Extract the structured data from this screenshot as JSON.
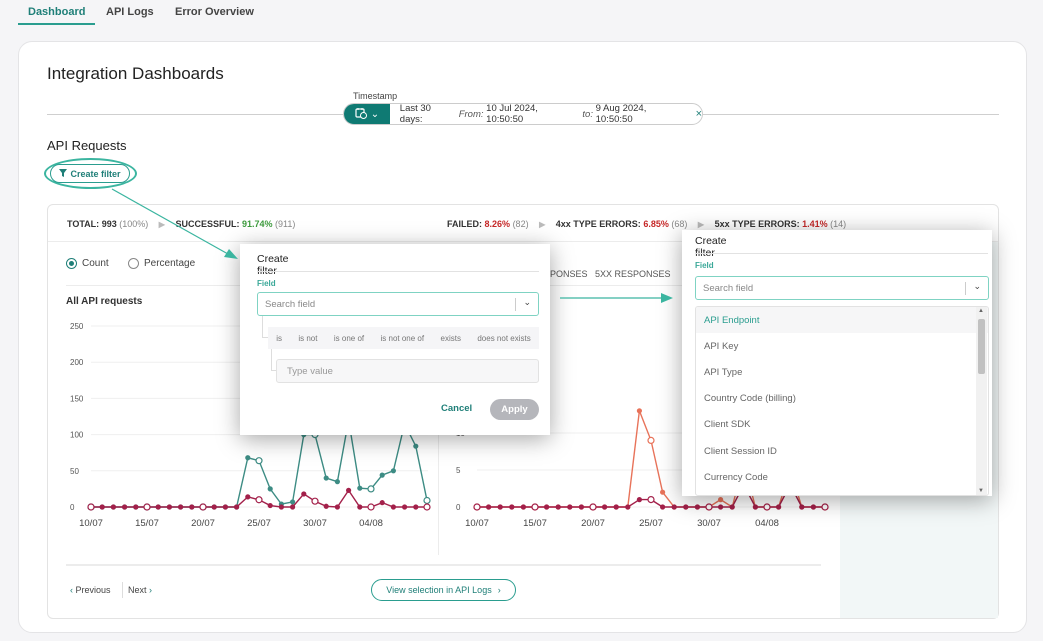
{
  "nav": {
    "tabs": [
      {
        "label": "Dashboard",
        "active": true
      },
      {
        "label": "API Logs"
      },
      {
        "label": "Error Overview"
      }
    ]
  },
  "page": {
    "title": "Integration Dashboards"
  },
  "timestamp": {
    "label": "Timestamp",
    "range_label": "Last 30 days:",
    "from_label": "From:",
    "from_value": "10 Jul 2024, 10:50:50",
    "to_label": "to:",
    "to_value": "9 Aug 2024, 10:50:50",
    "clear_icon": "×",
    "calendar_icon": "calendar-clock-icon"
  },
  "section": {
    "title": "API Requests",
    "create_filter_label": "Create filter"
  },
  "stats": {
    "total_label": "TOTAL:",
    "total_value": "993",
    "total_pct": "(100%)",
    "successful_label": "SUCCESSFUL:",
    "successful_pct": "91.74%",
    "successful_count": "(911)",
    "failed_label": "FAILED:",
    "failed_pct": "8.26%",
    "failed_count": "(82)",
    "e4xx_label": "4xx TYPE ERRORS:",
    "e4xx_pct": "6.85%",
    "e4xx_count": "(68)",
    "e5xx_label": "5xx TYPE ERRORS:",
    "e5xx_pct": "1.41%",
    "e5xx_count": "(14)"
  },
  "view_mode": {
    "count_label": "Count",
    "percentage_label": "Percentage",
    "selected": "Count"
  },
  "right_tabs": [
    "PONSES",
    "5XX RESPONSES"
  ],
  "pagination": {
    "previous": "Previous",
    "next": "Next",
    "view_selection": "View selection in API Logs"
  },
  "colors": {
    "accent": "#2a9d8f",
    "success": "#3c9a3c",
    "error": "#c62828",
    "series_teal": "#3d8c84",
    "series_maroon": "#a3204a",
    "series_orange": "#e8735a"
  },
  "filter_modal_left": {
    "title": "Create filter",
    "field_label": "Field",
    "search_placeholder": "Search field",
    "operators": [
      "is",
      "is not",
      "is one of",
      "is not one of",
      "exists",
      "does not exists"
    ],
    "value_placeholder": "Type value",
    "cancel": "Cancel",
    "apply": "Apply"
  },
  "filter_modal_right": {
    "title": "Create filter",
    "field_label": "Field",
    "search_placeholder": "Search field",
    "options": [
      "API Endpoint",
      "API Key",
      "API Type",
      "Country Code (billing)",
      "Client SDK",
      "Client Session ID",
      "Currency Code"
    ],
    "highlighted": "API Endpoint"
  },
  "chart_data": [
    {
      "type": "line",
      "title": "All API requests",
      "x": [
        "10/07",
        "11/07",
        "12/07",
        "13/07",
        "14/07",
        "15/07",
        "16/07",
        "17/07",
        "18/07",
        "19/07",
        "20/07",
        "21/07",
        "22/07",
        "23/07",
        "24/07",
        "25/07",
        "26/07",
        "27/07",
        "28/07",
        "29/07",
        "30/07",
        "31/07",
        "01/08",
        "02/08",
        "03/08",
        "04/08",
        "05/08",
        "06/08",
        "07/08",
        "08/08",
        "09/08"
      ],
      "x_tick_labels": [
        "10/07",
        "15/07",
        "20/07",
        "25/07",
        "30/07",
        "04/08"
      ],
      "y_ticks": [
        0,
        50,
        100,
        150,
        200,
        250
      ],
      "ylim": [
        0,
        250
      ],
      "grid": true,
      "series": [
        {
          "color": "#3d8c84",
          "values": [
            0,
            0,
            0,
            0,
            0,
            0,
            0,
            0,
            0,
            0,
            0,
            0,
            0,
            0,
            68,
            64,
            25,
            4,
            7,
            100,
            100,
            40,
            35,
            120,
            26,
            25,
            44,
            50,
            115,
            84,
            9
          ]
        },
        {
          "color": "#a3204a",
          "values": [
            0,
            0,
            0,
            0,
            0,
            0,
            0,
            0,
            0,
            0,
            0,
            0,
            0,
            0,
            14,
            10,
            2,
            0,
            0,
            18,
            8,
            1,
            0,
            23,
            0,
            0,
            6,
            0,
            0,
            0,
            0
          ]
        }
      ]
    },
    {
      "type": "line",
      "title": "",
      "x": [
        "10/07",
        "11/07",
        "12/07",
        "13/07",
        "14/07",
        "15/07",
        "16/07",
        "17/07",
        "18/07",
        "19/07",
        "20/07",
        "21/07",
        "22/07",
        "23/07",
        "24/07",
        "25/07",
        "26/07",
        "27/07",
        "28/07",
        "29/07",
        "30/07",
        "31/07",
        "01/08",
        "02/08",
        "03/08",
        "04/08",
        "05/08",
        "06/08",
        "07/08",
        "08/08",
        "09/08"
      ],
      "x_tick_labels": [
        "10/07",
        "15/07",
        "20/07",
        "25/07",
        "30/07",
        "04/08"
      ],
      "y_ticks": [
        0,
        5,
        10
      ],
      "ylim": [
        0,
        15
      ],
      "grid": true,
      "series": [
        {
          "color": "#e8735a",
          "values": [
            0,
            0,
            0,
            0,
            0,
            0,
            0,
            0,
            0,
            0,
            0,
            0,
            0,
            0,
            13,
            9,
            2,
            0,
            0,
            0,
            0,
            1,
            0,
            6,
            0,
            0,
            0,
            5,
            0,
            0,
            0
          ]
        },
        {
          "color": "#a3204a",
          "values": [
            0,
            0,
            0,
            0,
            0,
            0,
            0,
            0,
            0,
            0,
            0,
            0,
            0,
            0,
            1,
            1,
            0,
            0,
            0,
            0,
            0,
            0,
            0,
            3,
            0,
            0,
            0,
            3,
            0,
            0,
            0
          ]
        }
      ]
    }
  ]
}
